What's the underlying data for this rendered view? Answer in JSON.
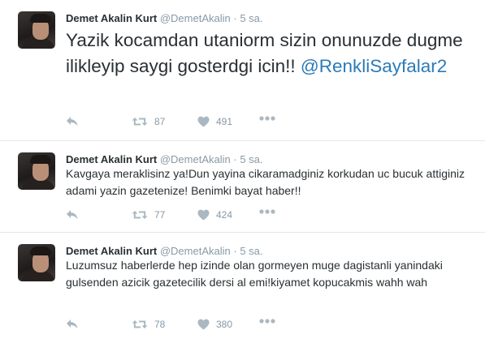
{
  "tweets": [
    {
      "name": "Demet Akalin Kurt",
      "handle": "@DemetAkalin",
      "separator": "·",
      "time": "5 sa.",
      "text_before": "Yazik kocamdan utaniorm sizin onunuzde dugme ilikleyip saygi gosterdgi icin!! ",
      "mention": "@RenkliSayfalar2",
      "retweets": "87",
      "likes": "491"
    },
    {
      "name": "Demet Akalin Kurt",
      "handle": "@DemetAkalin",
      "separator": "·",
      "time": "5 sa.",
      "text": "Kavgaya meraklisinz ya!Dun yayina cikaramadginiz korkudan  uc bucuk attiginiz adami yazin gazetenize! Benimki bayat haber!!",
      "retweets": "77",
      "likes": "424"
    },
    {
      "name": "Demet Akalin Kurt",
      "handle": "@DemetAkalin",
      "separator": "·",
      "time": "5 sa.",
      "text": "Luzumsuz haberlerde hep izinde olan gormeyen muge dagistanli yanindaki gulsenden azicik gazetecilik dersi al emi!kiyamet kopucakmis wahh wah",
      "retweets": "78",
      "likes": "380"
    }
  ],
  "icons": {
    "reply": "reply-icon",
    "retweet": "retweet-icon",
    "like": "heart-icon",
    "more": "more-dots-icon"
  },
  "colors": {
    "name": "#292f33",
    "meta": "#8899a6",
    "icon": "#aab8c2",
    "link": "#2b7bb9",
    "divider": "#e1e8ed"
  }
}
